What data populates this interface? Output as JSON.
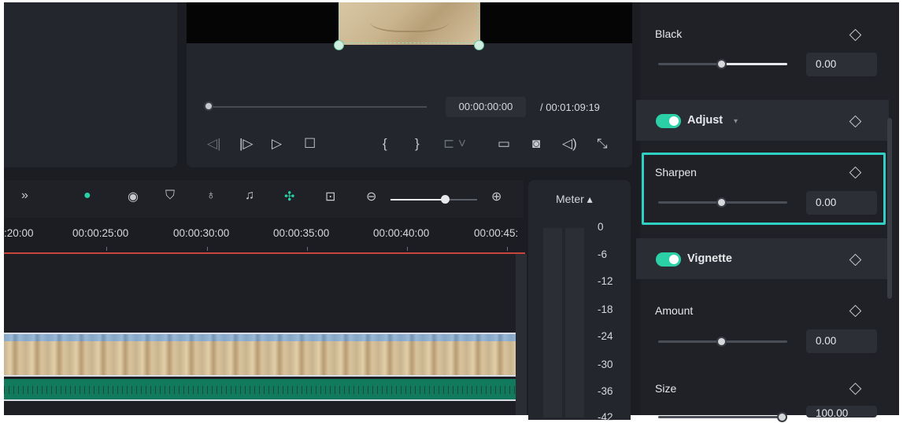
{
  "preview": {
    "current_time": "00:00:00:00",
    "duration": "/ 00:01:09:19"
  },
  "icons": {
    "prev_frame": "step-back-icon",
    "next_frame": "step-forward-icon",
    "play": "play-icon",
    "stop": "stop-icon",
    "mark_in": "mark-in-icon",
    "mark_out": "mark-out-icon",
    "render": "render-icon",
    "display": "display-settings-icon",
    "snapshot": "camera-icon",
    "volume": "volume-icon",
    "fullscreen": "fullscreen-icon"
  },
  "timeline": {
    "more": "»",
    "ruler_labels": [
      ":20:00",
      "00:00:25:00",
      "00:00:30:00",
      "00:00:35:00",
      "00:00:40:00",
      "00:00:45:"
    ],
    "zoom_level": 0.63
  },
  "meter": {
    "title": "Meter",
    "labels": [
      "0",
      "-6",
      "-12",
      "-18",
      "-24",
      "-30",
      "-36",
      "-42"
    ]
  },
  "properties": {
    "black": {
      "label": "Black",
      "value": "0.00",
      "level": 0.5
    },
    "adjust": {
      "label": "Adjust",
      "enabled": true
    },
    "sharpen": {
      "label": "Sharpen",
      "value": "0.00",
      "level": 0.5
    },
    "vignette": {
      "label": "Vignette",
      "enabled": true
    },
    "amount": {
      "label": "Amount",
      "value": "0.00",
      "level": 0.5
    },
    "size": {
      "label": "Size",
      "value": "100.00"
    }
  },
  "colors": {
    "accent": "#2bd0a6",
    "highlight": "#2fd1c4",
    "playhead_line": "#c9453c"
  }
}
